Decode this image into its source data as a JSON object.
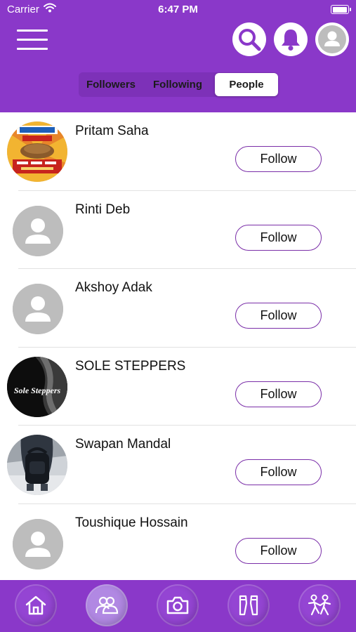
{
  "status_bar": {
    "carrier": "Carrier",
    "time": "6:47 PM",
    "battery_level": 1.0
  },
  "header": {
    "icons": {
      "menu": "hamburger-menu-icon",
      "search": "search-icon",
      "notifications": "bell-icon",
      "profile": "user-avatar-icon"
    }
  },
  "tabs": [
    {
      "label": "Followers",
      "active": false
    },
    {
      "label": "Following",
      "active": false
    },
    {
      "label": "People",
      "active": true
    }
  ],
  "people": [
    {
      "name": "Pritam Saha",
      "avatar": "grocery-banner-photo",
      "action": "Follow"
    },
    {
      "name": "Rinti Deb",
      "avatar": "default-avatar",
      "action": "Follow"
    },
    {
      "name": "Akshoy Adak",
      "avatar": "default-avatar",
      "action": "Follow"
    },
    {
      "name": "SOLE STEPPERS",
      "avatar": "sole-steppers-logo",
      "logo_text": "Sole Steppers",
      "action": "Follow"
    },
    {
      "name": "Swapan Mandal",
      "avatar": "backpack-photo",
      "action": "Follow"
    },
    {
      "name": "Toushique Hossain",
      "avatar": "default-avatar",
      "action": "Follow"
    }
  ],
  "bottom_nav": [
    {
      "icon": "home-icon",
      "active": false
    },
    {
      "icon": "people-icon",
      "active": true
    },
    {
      "icon": "camera-icon",
      "active": false
    },
    {
      "icon": "outfit-icon",
      "active": false
    },
    {
      "icon": "dance-icon",
      "active": false
    }
  ],
  "colors": {
    "primary": "#8a38c9",
    "follow_border": "#7a2ea8",
    "avatar_grey": "#bdbdbd"
  }
}
